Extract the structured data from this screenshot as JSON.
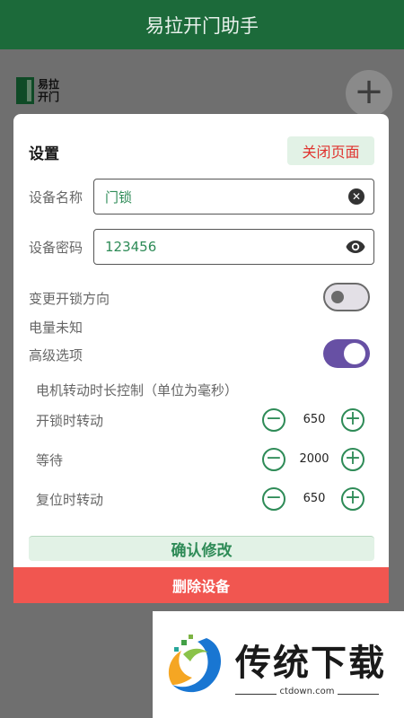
{
  "header": {
    "title": "易拉开门助手"
  },
  "background": {
    "logo_line1": "易拉",
    "logo_line2": "开门",
    "add_label": "+"
  },
  "dialog": {
    "title": "设置",
    "close_label": "关闭页面",
    "device_name": {
      "label": "设备名称",
      "value": "门锁"
    },
    "device_password": {
      "label": "设备密码",
      "value": "123456"
    },
    "change_direction": {
      "label": "变更开锁方向",
      "checked": false
    },
    "battery_status": "电量未知",
    "advanced": {
      "label": "高级选项",
      "checked": true
    },
    "motor_section_title": "电机转动时长控制（单位为毫秒）",
    "motor_rows": [
      {
        "label": "开锁时转动",
        "value": "650"
      },
      {
        "label": "等待",
        "value": "2000"
      },
      {
        "label": "复位时转动",
        "value": "650"
      }
    ],
    "confirm_label": "确认修改",
    "delete_label": "删除设备"
  },
  "watermark": {
    "brand": "传统下载",
    "url": "ctdown.com"
  },
  "colors": {
    "header": "#1c6a3a",
    "accent_green": "#2e8b57",
    "danger": "#f15650",
    "toggle_on": "#6750a4"
  }
}
